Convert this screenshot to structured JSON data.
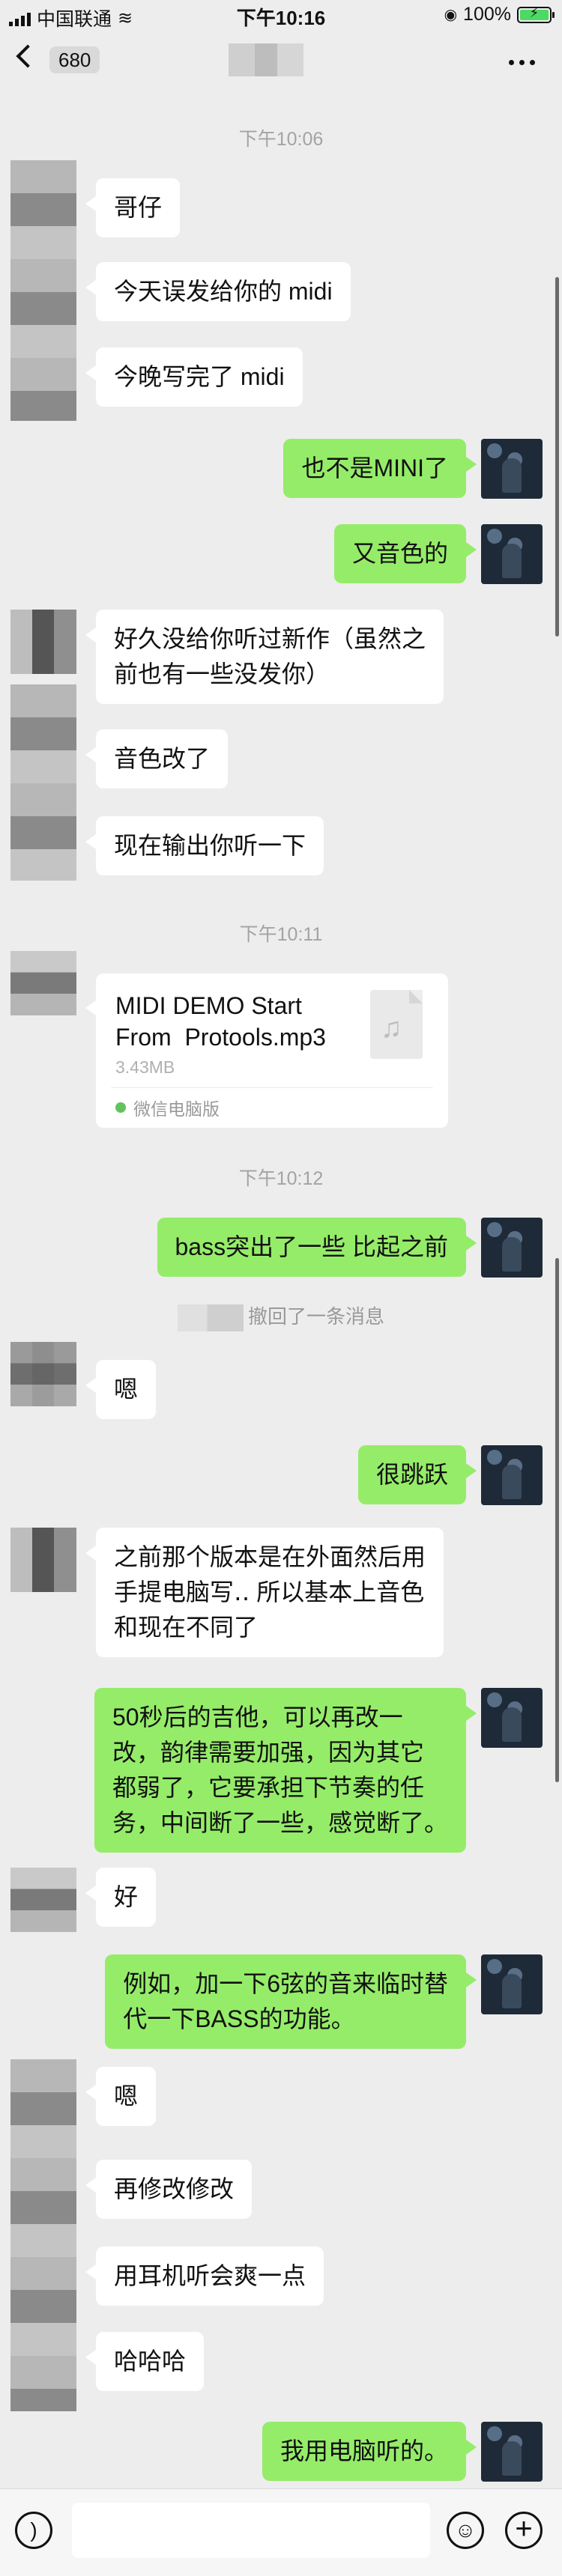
{
  "status_bar": {
    "carrier": "中国联通",
    "time": "下午10:16",
    "battery": "100%"
  },
  "nav": {
    "unread_count": "680"
  },
  "timestamps": [
    "下午10:06",
    "下午10:11",
    "下午10:12"
  ],
  "messages": [
    {
      "side": "in",
      "text": "哥仔"
    },
    {
      "side": "in",
      "text": "今天误发给你的 midi"
    },
    {
      "side": "in",
      "text": "今晚写完了 midi"
    },
    {
      "side": "out",
      "text": "也不是MINI了"
    },
    {
      "side": "out",
      "text": "又音色的"
    },
    {
      "side": "in",
      "text": "好久没给你听过新作（虽然之\n前也有一些没发你）"
    },
    {
      "side": "in",
      "text": "音色改了"
    },
    {
      "side": "in",
      "text": "现在输出你听一下"
    },
    {
      "side": "out",
      "text": "bass突出了一些 比起之前"
    },
    {
      "side": "in",
      "text": "嗯"
    },
    {
      "side": "out",
      "text": "很跳跃"
    },
    {
      "side": "in",
      "text": "之前那个版本是在外面然后用\n手提电脑写‥ 所以基本上音色\n和现在不同了"
    },
    {
      "side": "out",
      "text": "50秒后的吉他，可以再改一\n改，韵律需要加强，因为其它\n都弱了，它要承担下节奏的任\n务，中间断了一些，感觉断了。"
    },
    {
      "side": "in",
      "text": "好"
    },
    {
      "side": "out",
      "text": "例如，加一下6弦的音来临时替\n代一下BASS的功能。"
    },
    {
      "side": "in",
      "text": "嗯"
    },
    {
      "side": "in",
      "text": "再修改修改"
    },
    {
      "side": "in",
      "text": "用耳机听会爽一点"
    },
    {
      "side": "in",
      "text": "哈哈哈"
    },
    {
      "side": "out",
      "text": "我用电脑听的。"
    }
  ],
  "file_message": {
    "name": "MIDI DEMO Start\nFrom  Protools.mp3",
    "size": "3.43MB",
    "source": "微信电脑版",
    "icon": "music-note-icon"
  },
  "system_message": "撤回了一条消息",
  "input_bar": {
    "voice_icon": "voice-icon",
    "emoji_icon": "emoji-icon",
    "plus_icon": "plus-icon"
  },
  "colors": {
    "background": "#ededed",
    "outgoing_bubble": "#95ec69",
    "incoming_bubble": "#ffffff"
  }
}
